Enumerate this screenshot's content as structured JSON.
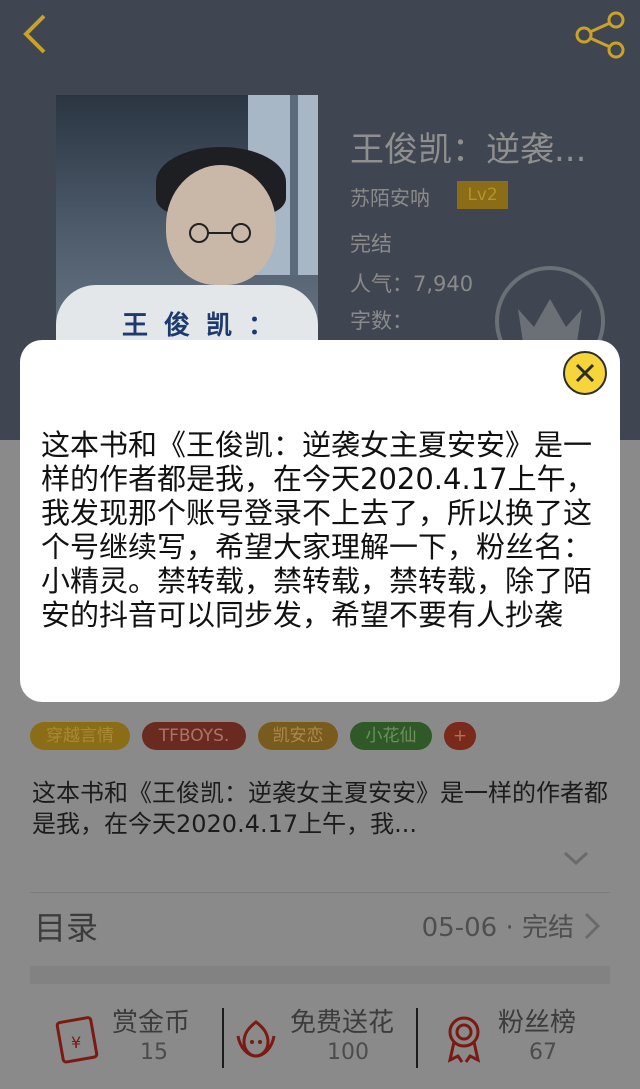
{
  "header": {
    "book_title": "王俊凯：逆袭...",
    "author": "苏陌安呐",
    "level": "Lv2",
    "status": "完结",
    "popularity": "人气：7,940",
    "word_count": "字数：",
    "cover_text": "王俊凯："
  },
  "tags": [
    "穿越言情",
    "TFBOYS.",
    "凯安恋",
    "小花仙",
    "+"
  ],
  "intro": "这本书和《王俊凯：逆袭女主夏安安》是一样的作者都是我，在今天2020.4.17上午，我...",
  "toc": {
    "label": "目录",
    "status": "05-06 · 完结"
  },
  "bottom_bar": {
    "reward": {
      "label": "赏金币",
      "count": "15"
    },
    "flower": {
      "label": "免费送花",
      "count": "100"
    },
    "fans": {
      "label": "粉丝榜",
      "count": "67"
    }
  },
  "modal": {
    "text": "这本书和《王俊凯：逆袭女主夏安安》是一样的作者都是我，在今天2020.4.17上午，我发现那个账号登录不上去了，所以换了这个号继续写，希望大家理解一下，粉丝名：小精灵。禁转载，禁转载，禁转载，除了陌安的抖音可以同步发，希望不要有人抄袭"
  },
  "colors": {
    "accent": "#f5d53a",
    "back_arrow": "#c9a227",
    "tag_1": "#8a6d16",
    "tag_2": "#6b2a20",
    "tag_3": "#7a5b1e",
    "tag_4": "#2f5a28",
    "tag_5": "#7a2a1a"
  }
}
